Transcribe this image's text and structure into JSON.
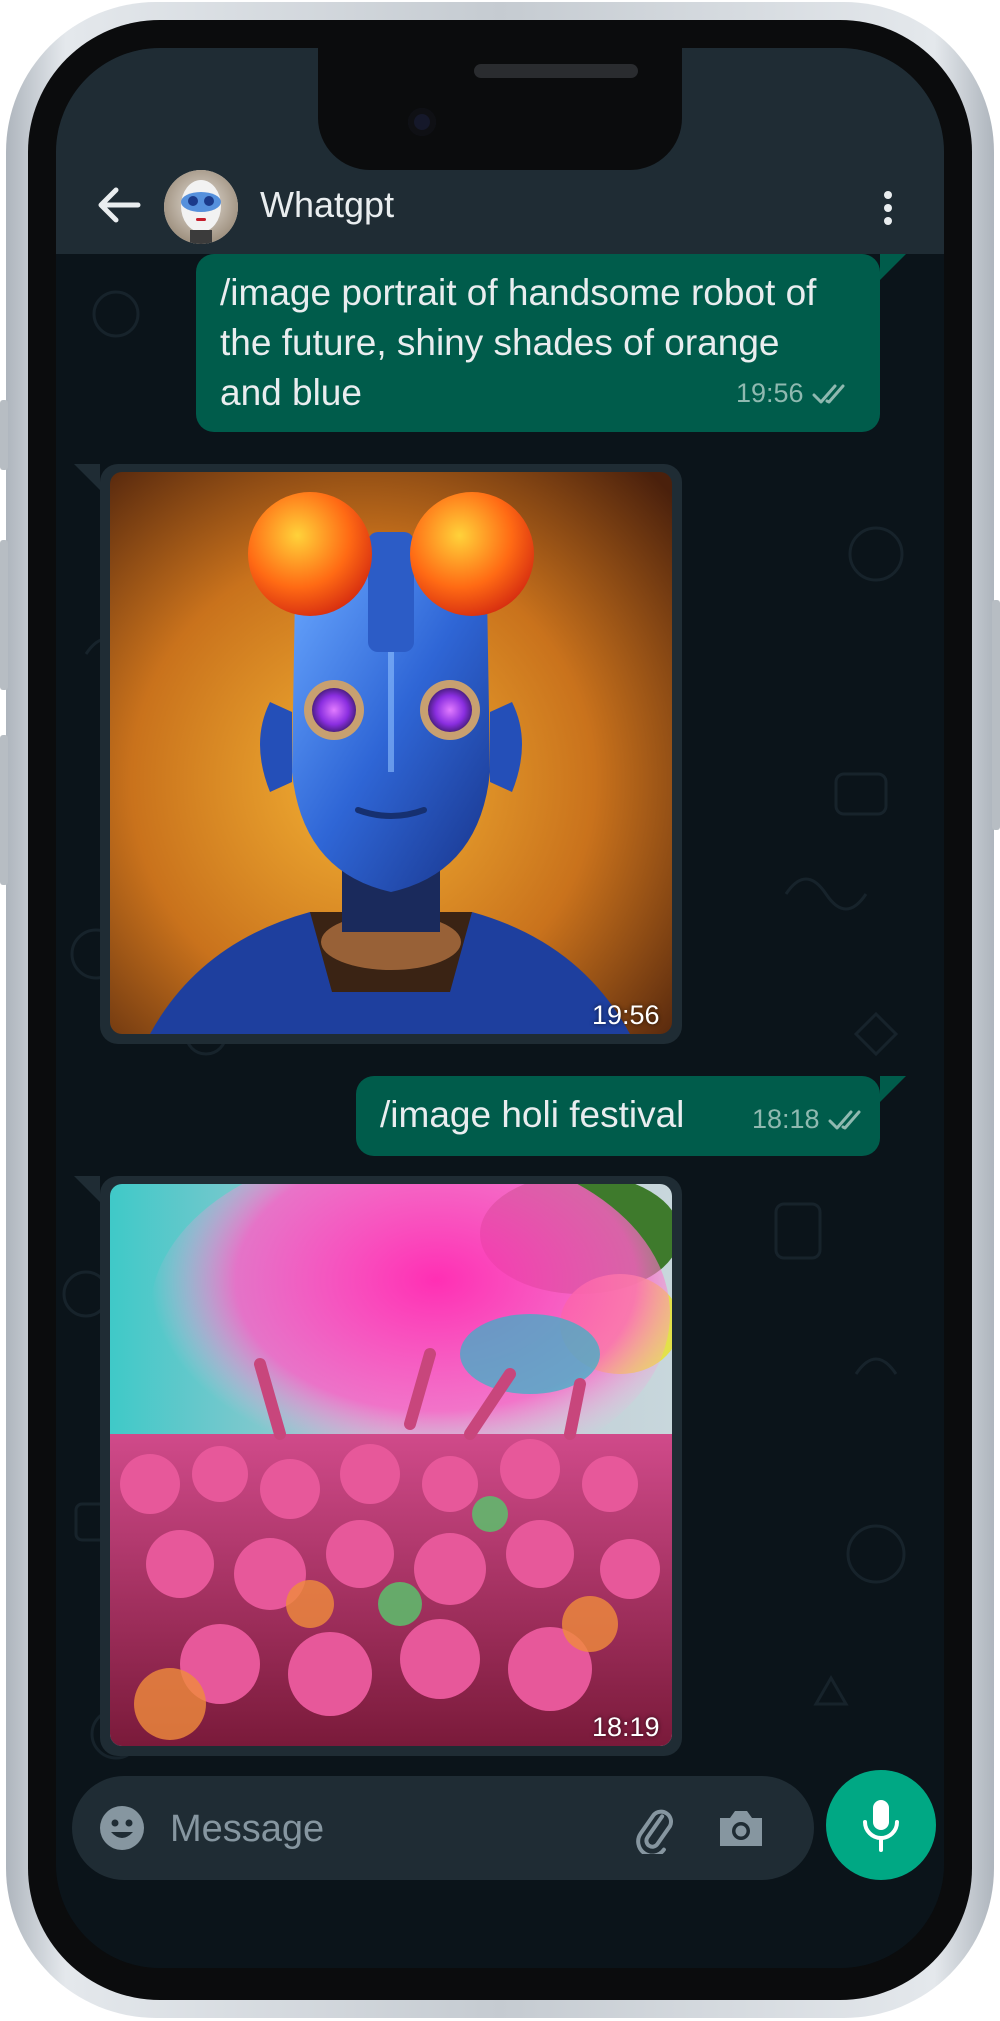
{
  "header": {
    "contact_name": "Whatgpt"
  },
  "messages": [
    {
      "type": "outgoing_text",
      "text": "/image portrait of  handsome robot of the future, shiny shades of orange and blue",
      "time": "19:56",
      "status": "read"
    },
    {
      "type": "incoming_image",
      "subject": "blue robot portrait with orange lenses",
      "time": "19:56"
    },
    {
      "type": "outgoing_text",
      "text": "/image holi festival",
      "time": "18:18",
      "status": "read"
    },
    {
      "type": "incoming_image",
      "subject": "holi festival crowd with pink color powder",
      "time": "18:19"
    }
  ],
  "composer": {
    "placeholder": "Message"
  },
  "icons": [
    "back-arrow-icon",
    "menu-dots-icon",
    "emoji-icon",
    "attach-icon",
    "camera-icon",
    "mic-icon",
    "read-ticks-icon"
  ],
  "colors": {
    "header_bg": "#1f2c34",
    "chat_bg": "#0b141a",
    "outgoing_bubble": "#005c4b",
    "incoming_bubble": "#1f2c34",
    "accent": "#00a884"
  }
}
